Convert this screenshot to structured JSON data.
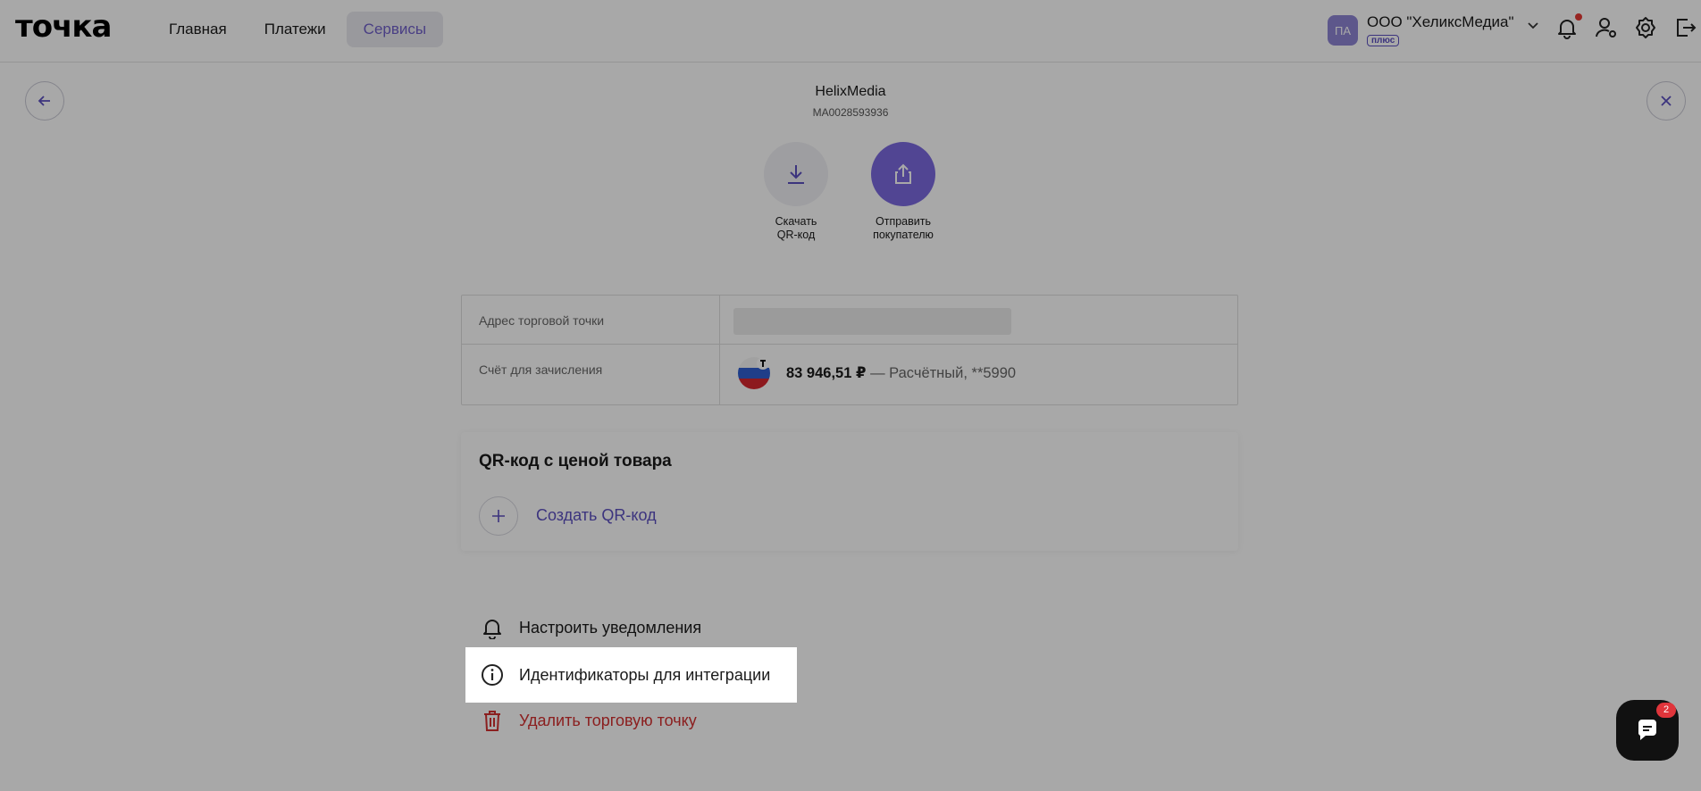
{
  "header": {
    "logo": "точка",
    "nav": [
      "Главная",
      "Платежи",
      "Сервисы"
    ],
    "active_nav": "Сервисы",
    "org_initials": "ПА",
    "org_name": "ООО \"ХеликсМедиа\"",
    "org_plan": "плюс",
    "notification_badge_color": "#e53935"
  },
  "page": {
    "title": "HelixMedia",
    "code": "MA0028593936"
  },
  "actions": [
    {
      "label_line1": "Скачать",
      "label_line2": "QR-код",
      "icon": "download-icon"
    },
    {
      "label_line1": "Отправить",
      "label_line2": "покупателю",
      "icon": "share-icon"
    }
  ],
  "info": {
    "address_label": "Адрес торговой точки",
    "account_label": "Счёт для зачисления",
    "account_amount": "83 946,51 ₽",
    "account_desc": " — Расчётный, **5990"
  },
  "qr_section": {
    "title": "QR-код с ценой товара",
    "create_label": "Создать QR-код"
  },
  "menu": {
    "notifications": "Настроить уведомления",
    "integration_ids": "Идентификаторы для интеграции",
    "delete_point": "Удалить торговую точку"
  },
  "chat": {
    "badge": "2"
  },
  "colors": {
    "accent": "#5c4fc0",
    "danger": "#d32f2f",
    "overlay": "rgba(0,0,0,0.34)"
  }
}
